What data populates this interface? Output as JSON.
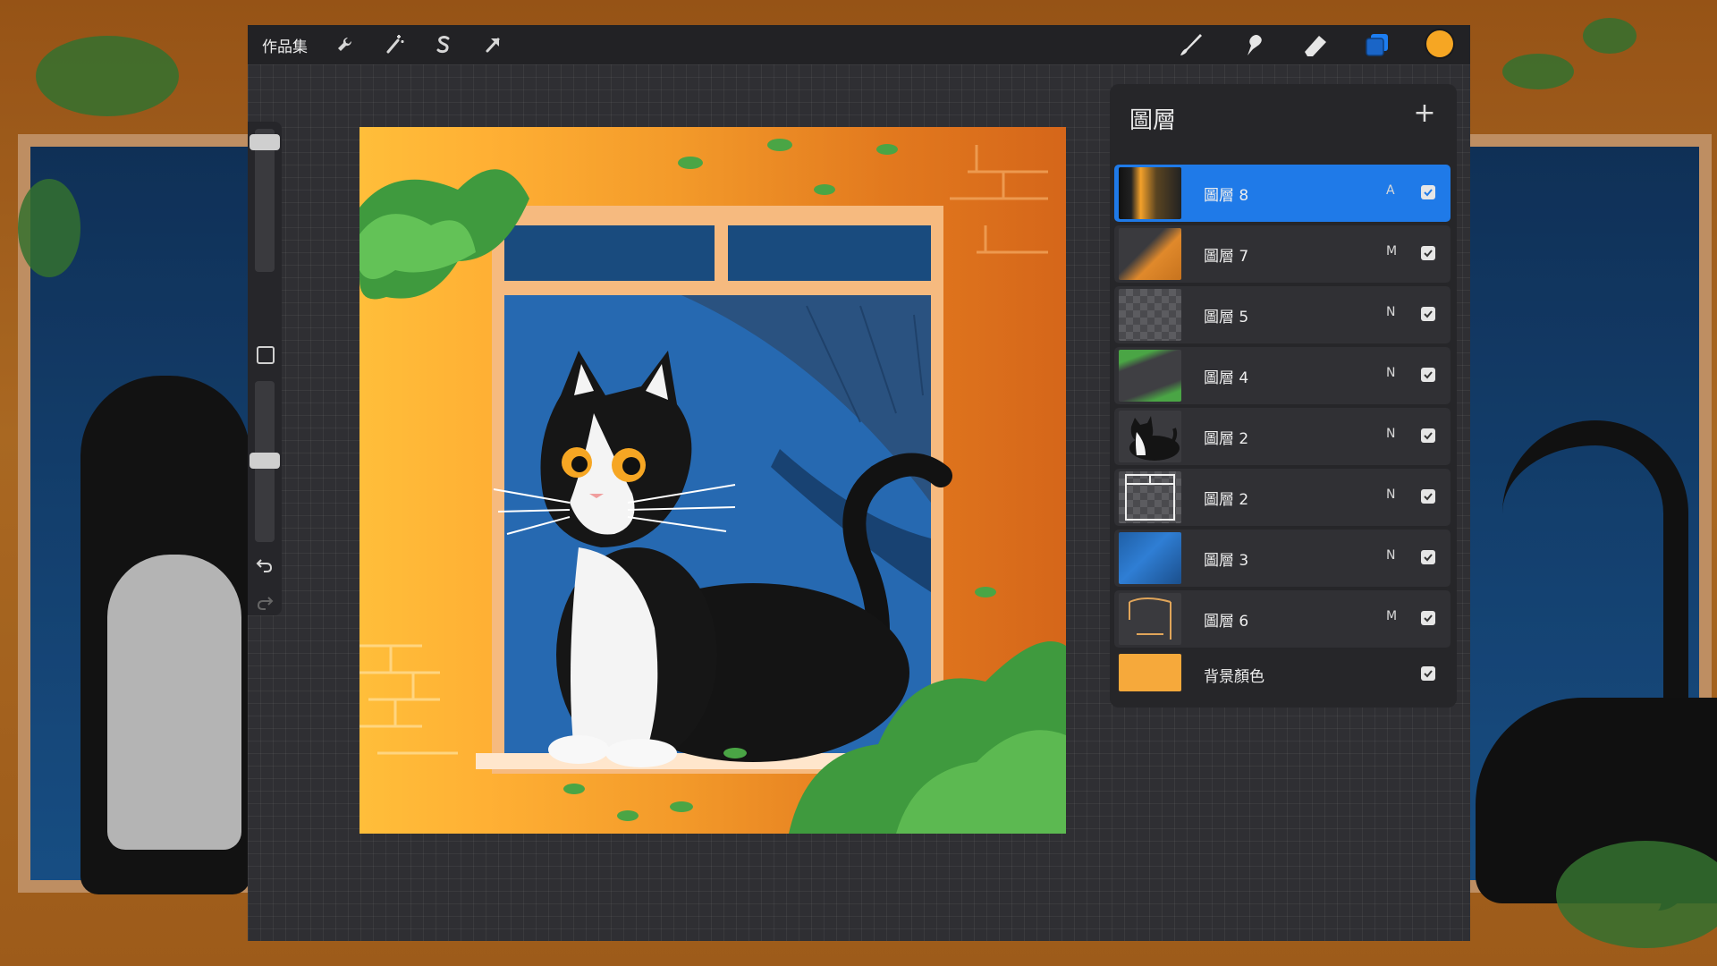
{
  "app": {
    "gallery_label": "作品集",
    "current_color": "#f6a623",
    "accent_color": "#1f7ae8"
  },
  "toolbar": {
    "left_icons": [
      "wrench-icon",
      "magic-wand-icon",
      "selection-icon",
      "transform-arrow-icon"
    ],
    "right_icons": [
      "brush-icon",
      "smudge-icon",
      "eraser-icon",
      "layers-icon"
    ]
  },
  "sidebar": {
    "brush_size_level": 0.95,
    "opacity_level": 0.5,
    "icons": [
      "modify-square-icon",
      "undo-icon",
      "redo-icon"
    ]
  },
  "layers_panel": {
    "title": "圖層",
    "add_icon": "plus-icon",
    "layers": [
      {
        "name": "圖層 8",
        "mode": "A",
        "visible": true,
        "selected": true
      },
      {
        "name": "圖層 7",
        "mode": "M",
        "visible": true
      },
      {
        "name": "圖層 5",
        "mode": "N",
        "visible": true
      },
      {
        "name": "圖層 4",
        "mode": "N",
        "visible": true
      },
      {
        "name": "圖層 2",
        "mode": "N",
        "visible": true
      },
      {
        "name": "圖層 2",
        "mode": "N",
        "visible": true
      },
      {
        "name": "圖層 3",
        "mode": "N",
        "visible": true
      },
      {
        "name": "圖層 6",
        "mode": "M",
        "visible": true
      }
    ],
    "background": {
      "name": "背景顏色",
      "color": "#f6a93b",
      "visible": true
    }
  }
}
